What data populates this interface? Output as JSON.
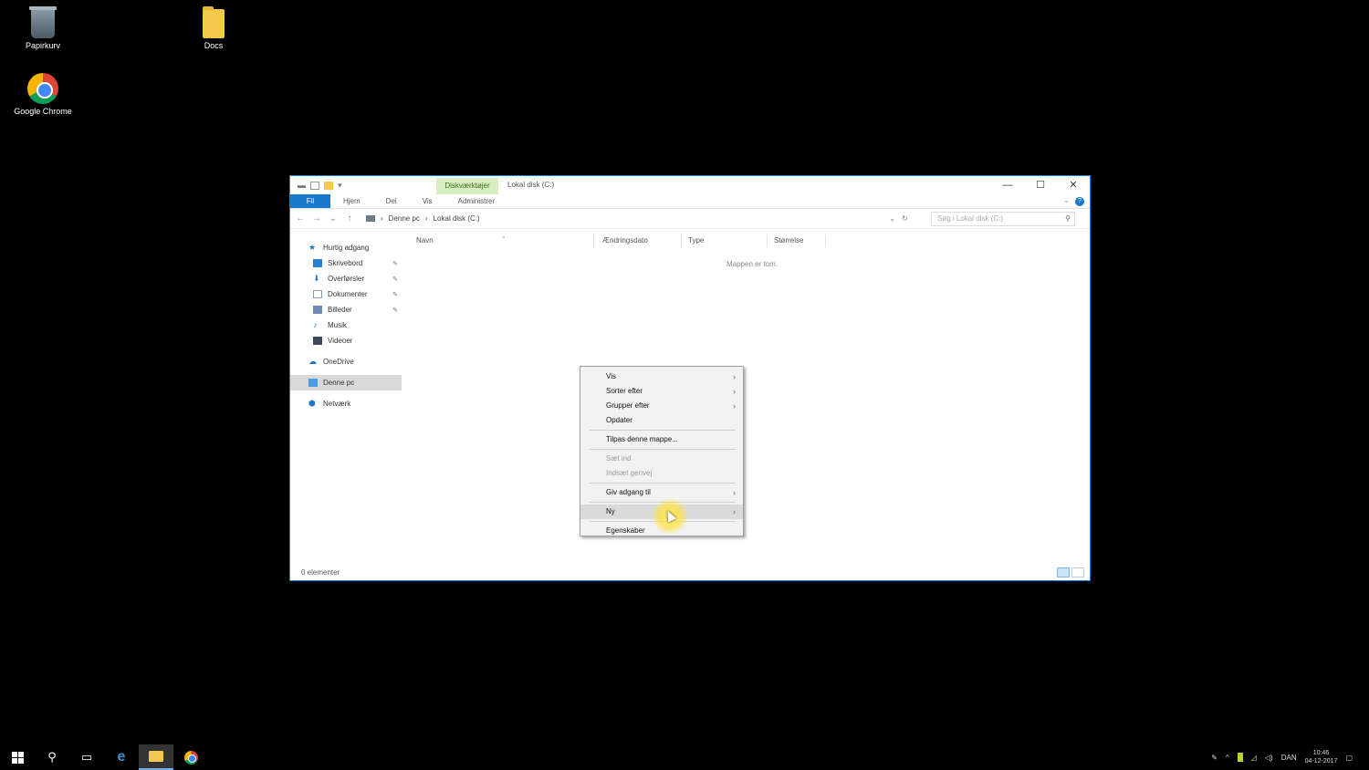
{
  "desktop": {
    "icons": [
      {
        "label": "Papirkurv",
        "icon": "recycle-bin-icon"
      },
      {
        "label": "Docs",
        "icon": "folder-icon"
      },
      {
        "label": "Google Chrome",
        "icon": "chrome-icon"
      }
    ]
  },
  "window": {
    "context_tab": "Diskværktøjer",
    "title": "Lokal disk (C:)",
    "controls": {
      "minimize": "—",
      "maximize": "☐",
      "close": "✕"
    },
    "ribbon_tabs": [
      "Fil",
      "Hjem",
      "Del",
      "Vis",
      "Administrer"
    ],
    "address": {
      "root": "Denne pc",
      "current": "Lokal disk (C:)"
    },
    "search_placeholder": "Søg i Lokal disk (C:)",
    "nav": [
      {
        "label": "Hurtig adgang",
        "icon": "star-icon",
        "level": 0
      },
      {
        "label": "Skrivebord",
        "icon": "desktop-icon",
        "level": 1,
        "pinned": true
      },
      {
        "label": "Overførsler",
        "icon": "download-icon",
        "level": 1,
        "pinned": true
      },
      {
        "label": "Dokumenter",
        "icon": "document-icon",
        "level": 1,
        "pinned": true
      },
      {
        "label": "Billeder",
        "icon": "picture-icon",
        "level": 1,
        "pinned": true
      },
      {
        "label": "Musik",
        "icon": "music-icon",
        "level": 1
      },
      {
        "label": "Videoer",
        "icon": "video-icon",
        "level": 1
      },
      {
        "label": "OneDrive",
        "icon": "cloud-icon",
        "level": 0
      },
      {
        "label": "Denne pc",
        "icon": "pc-icon",
        "level": 0,
        "selected": true
      },
      {
        "label": "Netværk",
        "icon": "network-icon",
        "level": 0
      }
    ],
    "columns": [
      "Navn",
      "Ændringsdato",
      "Type",
      "Størrelse"
    ],
    "empty_text": "Mappen er tom.",
    "status": "0 elementer"
  },
  "context_menu": {
    "items": [
      {
        "label": "Vis",
        "submenu": true
      },
      {
        "label": "Sorter efter",
        "submenu": true
      },
      {
        "label": "Grupper efter",
        "submenu": true
      },
      {
        "label": "Opdater"
      },
      {
        "sep": true
      },
      {
        "label": "Tilpas denne mappe..."
      },
      {
        "sep": true
      },
      {
        "label": "Sæt ind",
        "disabled": true
      },
      {
        "label": "Indsæt genvej",
        "disabled": true
      },
      {
        "sep": true
      },
      {
        "label": "Giv adgang til",
        "submenu": true
      },
      {
        "sep": true
      },
      {
        "label": "Ny",
        "submenu": true,
        "highlighted": true
      },
      {
        "sep": true
      },
      {
        "label": "Egenskaber"
      }
    ]
  },
  "taskbar": {
    "tray": {
      "lang": "DAN",
      "time": "10:46",
      "date": "04-12-2017"
    }
  },
  "colors": {
    "accent": "#1979ca",
    "context_tab": "#d8eec0",
    "desktop": "#000000"
  }
}
